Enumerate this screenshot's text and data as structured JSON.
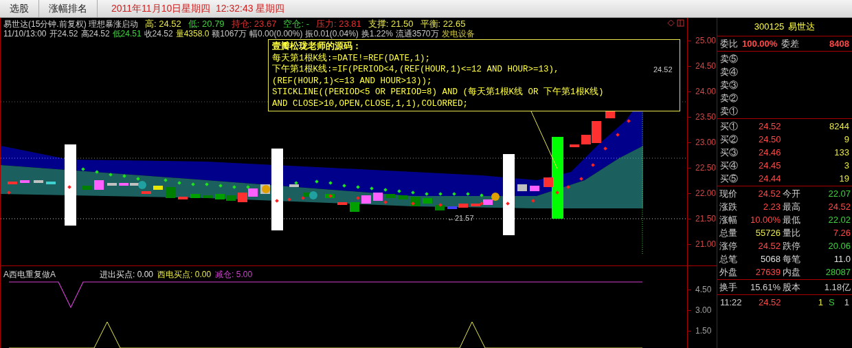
{
  "toolbar": {
    "tabs": [
      {
        "label": "选股",
        "selected": false
      },
      {
        "label": "涨幅排名",
        "selected": false
      }
    ],
    "datetime": "2011年11月10日星期四  12:32:43 星期四"
  },
  "chart_header": {
    "title": "易世达(15分钟.前复权) 理想暴涨启动",
    "stats": [
      {
        "label": "高:",
        "value": "24.52",
        "color": "#e8e84c"
      },
      {
        "label": "低:",
        "value": "20.79",
        "color": "#40d040"
      },
      {
        "label": "持仓:",
        "value": "23.67",
        "color": "#e03030"
      },
      {
        "label": "空仓:",
        "value": "-",
        "color": "#40d040"
      },
      {
        "label": "压力:",
        "value": "23.81",
        "color": "#e03030"
      },
      {
        "label": "支撑:",
        "value": "21.50",
        "color": "#e8e84c"
      },
      {
        "label": "平衡:",
        "value": "22.65",
        "color": "#e8e84c"
      }
    ]
  },
  "bar_info": {
    "time": "11/10/13:00",
    "fields": [
      {
        "text": "开24.52",
        "color": "#c8c8c8"
      },
      {
        "text": "高24.52",
        "color": "#c8c8c8"
      },
      {
        "text": "低24.51",
        "color": "#40d040"
      },
      {
        "text": "收24.52",
        "color": "#c8c8c8"
      },
      {
        "text": "量4358.0",
        "color": "#e8e84c"
      },
      {
        "text": "额1067万",
        "color": "#c8c8c8"
      },
      {
        "text": "幅0.00(0.00%)",
        "color": "#c8c8c8"
      },
      {
        "text": "振0.01(0.04%)",
        "color": "#c8c8c8"
      },
      {
        "text": "换1.22%",
        "color": "#c8c8c8"
      },
      {
        "text": "流通3570万",
        "color": "#c8c8c8"
      },
      {
        "text": "发电设备",
        "color": "#c8c040"
      }
    ]
  },
  "code_box": {
    "lines": [
      "壹瓣松珑老师的源码：",
      "每天第1根K线:=DATE!=REF(DATE,1);",
      "下午第1根K线:=IF(PERIOD<4,(REF(HOUR,1)<=12 AND HOUR>=13),",
      "(REF(HOUR,1)<=13 AND HOUR>13));",
      "STICKLINE((PERIOD<5 OR PERIOD=8) AND (每天第1根K线 OR 下午第1根K线)",
      "AND CLOSE>10,OPEN,CLOSE,1,1),COLORRED;"
    ]
  },
  "chart_labels": {
    "last_price": "24.52",
    "low_mark": "←21.57"
  },
  "price_axis": [
    "25.00",
    "24.50",
    "24.00",
    "23.50",
    "23.00",
    "22.50",
    "22.00",
    "21.50",
    "21.00"
  ],
  "indicator": {
    "title": "A西电重复做A",
    "values": [
      {
        "label": "进出买点:",
        "value": "0.00",
        "color": "#e0e0e0"
      },
      {
        "label": "西电买点:",
        "value": "0.00",
        "color": "#e8e84c"
      },
      {
        "label": "减仓:",
        "value": "5.00",
        "color": "#d040d0"
      }
    ],
    "axis": [
      "4.50",
      "3.00",
      "1.50"
    ]
  },
  "quote": {
    "code": "300125",
    "name": "易世达",
    "ratio": [
      {
        "label": "委比",
        "value": "100.00%"
      },
      {
        "label": "委差",
        "value": "8408"
      }
    ],
    "sells": [
      {
        "label": "卖⑤"
      },
      {
        "label": "卖④"
      },
      {
        "label": "卖③"
      },
      {
        "label": "卖②"
      },
      {
        "label": "卖①"
      }
    ],
    "buys": [
      {
        "label": "买①",
        "price": "24.52",
        "volume": "8244"
      },
      {
        "label": "买②",
        "price": "24.50",
        "volume": "9"
      },
      {
        "label": "买③",
        "price": "24.46",
        "volume": "133"
      },
      {
        "label": "买④",
        "price": "24.45",
        "volume": "3"
      },
      {
        "label": "买⑤",
        "price": "24.44",
        "volume": "19"
      }
    ],
    "stats": [
      {
        "label": "现价",
        "value": "24.52",
        "color": "#ff4848"
      },
      {
        "label": "今开",
        "value": "22.07",
        "color": "#40d040"
      },
      {
        "label": "涨跌",
        "value": "2.23",
        "color": "#ff4848"
      },
      {
        "label": "最高",
        "value": "24.52",
        "color": "#ff4848"
      },
      {
        "label": "涨幅",
        "value": "10.00%",
        "color": "#ff4848"
      },
      {
        "label": "最低",
        "value": "22.02",
        "color": "#40d040"
      },
      {
        "label": "总量",
        "value": "55726",
        "color": "#e8e84c"
      },
      {
        "label": "量比",
        "value": "7.26",
        "color": "#ff4848"
      },
      {
        "label": "涨停",
        "value": "24.52",
        "color": "#ff4848"
      },
      {
        "label": "跌停",
        "value": "20.06",
        "color": "#40d040"
      },
      {
        "label": "总笔",
        "value": "5068",
        "color": "#e0e0e0"
      },
      {
        "label": "每笔",
        "value": "11.0",
        "color": "#e0e0e0"
      },
      {
        "label": "外盘",
        "value": "27639",
        "color": "#ff4848"
      },
      {
        "label": "内盘",
        "value": "28087",
        "color": "#40d040"
      }
    ],
    "turnover": [
      {
        "label": "换手",
        "value": "15.61%"
      },
      {
        "label": "股本",
        "value": "1.18亿"
      }
    ],
    "ticks": [
      {
        "time": "11:22",
        "price": "24.52",
        "volume": "1",
        "side": "S",
        "column_5": "1"
      }
    ]
  }
}
